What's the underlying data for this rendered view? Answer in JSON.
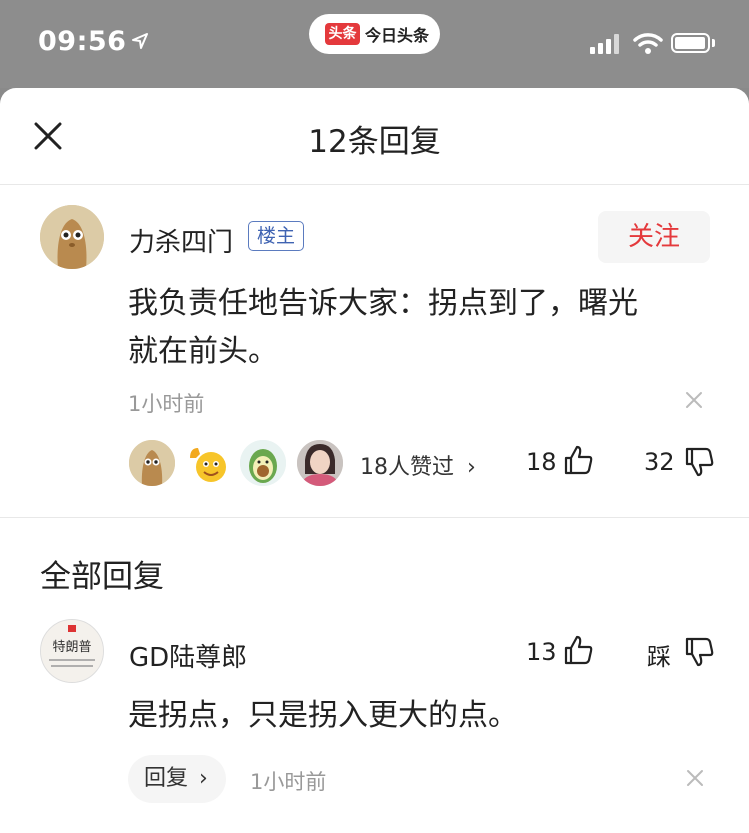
{
  "status_bar": {
    "time": "09:56",
    "app_logo_text": "头条",
    "app_name": "今日头条"
  },
  "sheet": {
    "title": "12条回复"
  },
  "main_comment": {
    "username": "力杀四门",
    "badge": "楼主",
    "follow_label": "关注",
    "text_line1": "我负责任地告诉大家：拐点到了，曙光",
    "text_line2": "就在前头。",
    "time": "1小时前",
    "likes_summary": "18人赞过",
    "likes_chevron": "›",
    "like_count": "18",
    "dislike_count": "32"
  },
  "all_replies": {
    "title": "全部回复",
    "items": [
      {
        "username": "GD陆尊郎",
        "like_count": "13",
        "dislike_label": "踩",
        "text": "是拐点，只是拐入更大的点。",
        "reply_label": "回复",
        "reply_chevron": "›",
        "time": "1小时前",
        "avatar_text": "特朗普"
      }
    ]
  },
  "colors": {
    "accent_red": "#e4393c",
    "badge_blue": "#3f63b2",
    "muted_text": "#999999"
  }
}
